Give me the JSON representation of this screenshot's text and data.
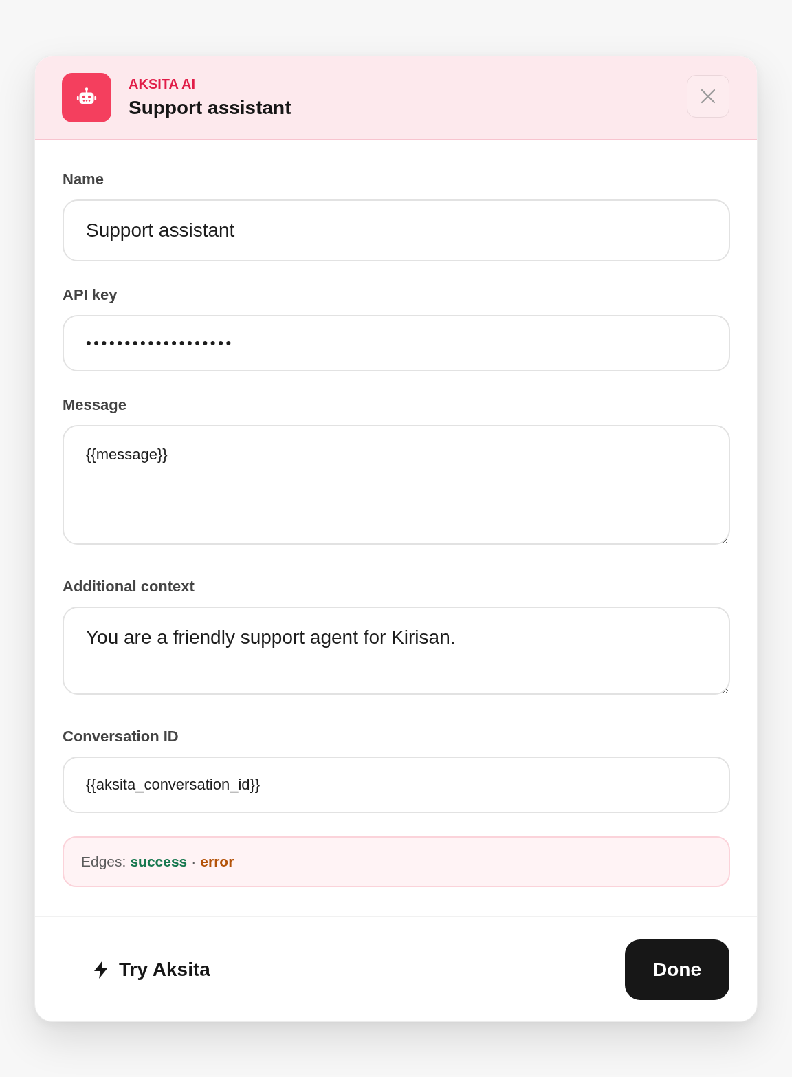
{
  "header": {
    "kicker": "AKSITA AI",
    "title": "Support assistant"
  },
  "fields": [
    {
      "kind": "input",
      "label": "Name",
      "value": "Support assistant"
    },
    {
      "kind": "secret",
      "label": "API key",
      "value": "•••••••••••••••••••"
    },
    {
      "kind": "textarea",
      "label": "Message",
      "value": "{{message}}"
    },
    {
      "kind": "textarea",
      "label": "Additional context",
      "value": "You are a friendly support agent for Kirisan."
    },
    {
      "kind": "input",
      "label": "Conversation ID",
      "value": "{{aksita_conversation_id}}"
    }
  ],
  "edges": {
    "label": "Edges:",
    "separator": "·",
    "items": [
      {
        "label": "success",
        "color": "#17784f"
      },
      {
        "label": "error",
        "color": "#b45309"
      }
    ]
  },
  "footer": {
    "secondary": "Try Aksita",
    "primary": "Done"
  }
}
